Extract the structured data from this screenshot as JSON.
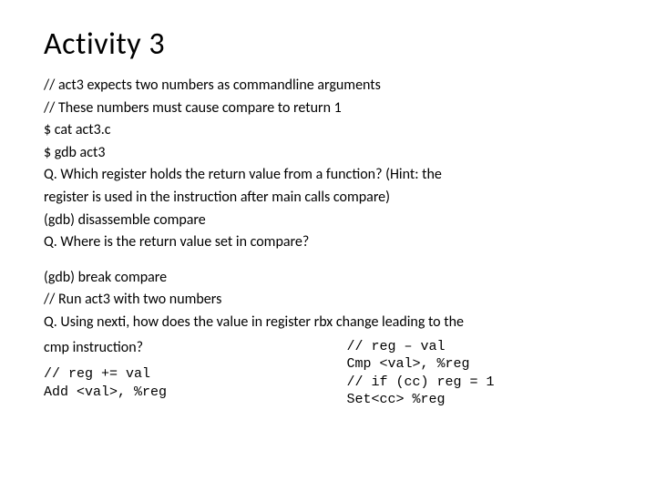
{
  "title": "Activity 3",
  "lines": {
    "l1": "// act3 expects two numbers as commandline arguments",
    "l2": "// These numbers must cause compare to return 1",
    "l3": "$ cat act3.c",
    "l4": "$ gdb act3",
    "l5a": "Q. Which register holds the return value from a function?  (Hint: the",
    "l5b": "register is used in the instruction after main calls compare)",
    "l6": "(gdb) disassemble compare",
    "l7": "Q. Where is the return value set in compare?",
    "l8": "(gdb) break compare",
    "l9": "// Run act3 with two numbers",
    "l10a": "Q. Using nexti, how does the value in register rbx change leading to the",
    "l10b": "cmp instruction?"
  },
  "left": {
    "m1": "// reg += val",
    "m2": "Add <val>, %reg"
  },
  "right": {
    "m1": "// reg – val",
    "m2": "Cmp <val>, %reg",
    "m3": "// if (cc) reg = 1",
    "m4": "Set<cc> %reg"
  }
}
